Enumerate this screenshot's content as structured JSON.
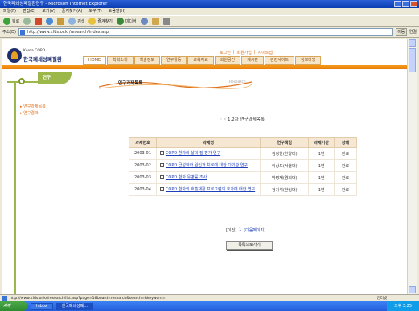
{
  "window": {
    "title": "한국폐쇄성폐질환연구 - Microsoft Internet Explorer"
  },
  "menu": [
    "파일(F)",
    "편집(E)",
    "보기(V)",
    "즐겨찾기(A)",
    "도구(T)",
    "도움말(H)"
  ],
  "toolbar": {
    "back": "뒤로",
    "search": "검색",
    "favorites": "즐겨찾기",
    "media": "미디어"
  },
  "address": {
    "label": "주소(D)",
    "url": "http://www.kfds.or.kr/research/index.asp",
    "go": "이동",
    "links": "연결"
  },
  "site": {
    "logo_small": "Korea COPD",
    "logo_name": "한국폐쇄성폐질환",
    "top_links": [
      "로그인",
      "회원가입",
      "사이트맵"
    ],
    "nav": [
      "HOME",
      "학회소개",
      "학술정보",
      "연구활동",
      "교육자료",
      "회원공간",
      "게시판",
      "관련사이트",
      "정보마당"
    ]
  },
  "leftnav": {
    "section_title": "연구",
    "links": [
      "연구과제목록",
      "연구결과"
    ]
  },
  "content": {
    "page_title": "연구과제목록",
    "banner_sub": "Research",
    "section_heading": "◦ 1,2차 연구과제목록",
    "table": {
      "headers": [
        "과제번호",
        "과제명",
        "연구책임",
        "과제기간",
        "상태"
      ],
      "rows": [
        {
          "no": "2003-01",
          "title": "COPD 환자의 삶의 질 평가 연구",
          "lead": "김정한(한양대)",
          "period": "1년",
          "status": "완료"
        },
        {
          "no": "2003-02",
          "title": "COPD 급성악화 원인과 치료에 대한 다기관 연구",
          "lead": "이상도(서울대)",
          "period": "1년",
          "status": "완료"
        },
        {
          "no": "2003-03",
          "title": "COPD 환자 유병률 조사",
          "lead": "박명재(경희대)",
          "period": "1년",
          "status": "완료"
        },
        {
          "no": "2003-04",
          "title": "COPD 환자의 호흡재활 프로그램의 효과에 대한 연구",
          "lead": "정기석(한림대)",
          "period": "1년",
          "status": "완료"
        }
      ]
    },
    "pager": {
      "prev": "[이전]",
      "pages": "1",
      "next": "[다음페이지]"
    },
    "list_button": "목록으로가기"
  },
  "status": {
    "text": "http://www.kfds.or.kr/research/list.asp?page=1&board=research&search=&keyword=",
    "zone": "인터넷"
  },
  "taskbar": {
    "start": "시작",
    "tasks": [
      "Inbox",
      "한국폐쇄성폐..."
    ],
    "clock": "오후 3:25"
  }
}
